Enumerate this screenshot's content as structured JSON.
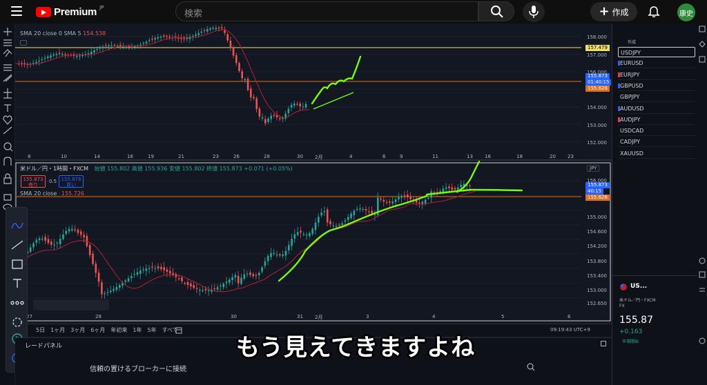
{
  "header": {
    "logo_text": "Premium",
    "logo_region": "JP",
    "search_placeholder": "検索",
    "create_label": "作成",
    "avatar_text": "康史"
  },
  "top_chart": {
    "indicator_label": "SMA 20 close 0 SMA 5",
    "indicator_value": "154.538",
    "price_axis": [
      "158.000",
      "157.000",
      "156.000",
      "155.000",
      "154.000",
      "153.000",
      "152.000"
    ],
    "tag_yellow": "157.479",
    "tag_blue": "155.873",
    "tag_blue_time": "01:40:15",
    "tag_orange": "155.626",
    "date_axis": [
      "8",
      "10",
      "14",
      "16",
      "19",
      "21",
      "23",
      "26",
      "28",
      "30",
      "2月",
      "4",
      "6",
      "9",
      "11",
      "13",
      "16",
      "18",
      "20",
      "23"
    ]
  },
  "bottom_chart": {
    "symbol_label": "米ドル／円・1時間・FXCM",
    "ohlc": "始値 155.802 高値 155.936 安値 155.802 終値 155.873 +0.071 (+0.05%)",
    "sell_price": "155.873",
    "sell_label": "売り",
    "spread": "0.5",
    "buy_price": "155.878",
    "buy_label": "買い",
    "indicator_label": "SMA 20 close",
    "indicator_value": "155.726",
    "currency": "JPY",
    "price_axis": [
      "156.000",
      "155.000",
      "154.600",
      "154.200",
      "153.800",
      "153.400",
      "153.000",
      "152.650"
    ],
    "tag_blue": "155.873",
    "tag_blue_time": "40:15",
    "tag_orange": "155.626",
    "date_axis": [
      "27",
      "28",
      "30",
      "31",
      "2月",
      "3",
      "4",
      "5",
      "6"
    ]
  },
  "timeframes": [
    "5日",
    "1ヶ月",
    "3ヶ月",
    "6ヶ月",
    "年初来",
    "1年",
    "5年",
    "すべて"
  ],
  "clock": "09:19:43 UTC+9",
  "bottom_panel": {
    "tab_label": "レードパネル",
    "broker_text": "信頼の置けるブローカーに接続"
  },
  "watchlist": {
    "header": "作成",
    "items": [
      {
        "symbol": "USDJPY",
        "flag": ""
      },
      {
        "symbol": "EURUSD",
        "flag": "#2962ff"
      },
      {
        "symbol": "EURJPY",
        "flag": "#f23645"
      },
      {
        "symbol": "GBPUSD",
        "flag": "#2962ff"
      },
      {
        "symbol": "GBPJPY",
        "flag": ""
      },
      {
        "symbol": "AUDUSD",
        "flag": "#2962ff"
      },
      {
        "symbol": "AUDJPY",
        "flag": "#f23645"
      },
      {
        "symbol": "USDCAD",
        "flag": ""
      },
      {
        "symbol": "CADJPY",
        "flag": ""
      },
      {
        "symbol": "XAUUSD",
        "flag": ""
      }
    ]
  },
  "detail": {
    "symbol": "US...",
    "name": "米ドル／円・FXCM",
    "type": "FX",
    "price": "155.87",
    "change": "+0.163",
    "status": "市場開始"
  },
  "subtitle": "もう見えてきますよね",
  "colors": {
    "up": "#26a69a",
    "down": "#ef5350",
    "drawing": "#7cfc00",
    "sma": "#b22234",
    "hline_yellow": "#f0e060",
    "hline_orange": "#e07020"
  }
}
